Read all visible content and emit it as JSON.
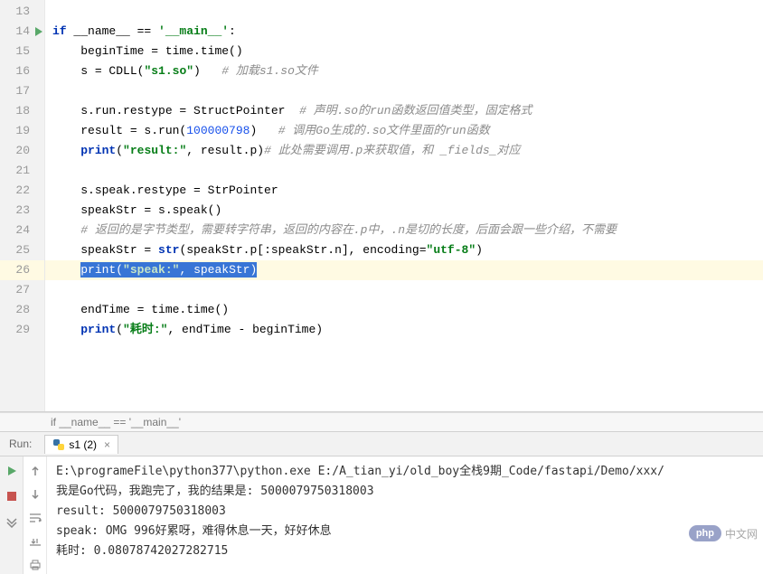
{
  "gutter": {
    "start": 13,
    "end": 29,
    "run_line": 14,
    "highlight_line": 26
  },
  "code": {
    "l14_if": "if",
    "l14_name": " __name__ == ",
    "l14_main": "'__main__'",
    "l14_colon": ":",
    "l15": "beginTime = time.time()",
    "l16a": "s = CDLL(",
    "l16b": "\"s1.so\"",
    "l16c": ")   ",
    "l16d": "# 加载s1.so文件",
    "l18a": "s.run.restype = StructPointer  ",
    "l18b": "# 声明.so的run函数返回值类型，固定格式",
    "l19a": "result = s.run(",
    "l19b": "100000798",
    "l19c": ")   ",
    "l19d": "# 调用Go生成的.so文件里面的run函数",
    "l20a": "print",
    "l20b": "(",
    "l20c": "\"result:\"",
    "l20d": ", result.p)",
    "l20e": "# 此处需要调用.p来获取值，和 _fields_对应",
    "l22": "s.speak.restype = StrPointer",
    "l23": "speakStr = s.speak()",
    "l24": "# 返回的是字节类型，需要转字符串，返回的内容在.p中，.n是切的长度，后面会跟一些介绍，不需要",
    "l25a": "speakStr = ",
    "l25b": "str",
    "l25c": "(speakStr.p[:speakStr.n], ",
    "l25d": "encoding",
    "l25e": "=",
    "l25f": "\"utf-8\"",
    "l25g": ")",
    "l26a": "print",
    "l26b": "(",
    "l26c": "\"speak:\"",
    "l26d": ", speakStr)",
    "l28": "endTime = time.time()",
    "l29a": "print",
    "l29b": "(",
    "l29c": "\"耗时:\"",
    "l29d": ", endTime - beginTime)"
  },
  "breadcrumb": "if __name__ == '__main__'",
  "run": {
    "label": "Run:",
    "tab": "s1 (2)",
    "command": "E:\\programeFile\\python377\\python.exe E:/A_tian_yi/old_boy全栈9期_Code/fastapi/Demo/xxx/",
    "out1": "我是Go代码，我跑完了，我的结果是: 5000079750318003",
    "out2": "result: 5000079750318003",
    "out3": "speak: OMG 996好累呀，难得休息一天，好好休息",
    "out4": "耗时: 0.08078742027282715"
  },
  "watermark": {
    "badge": "php",
    "text": "中文网"
  }
}
